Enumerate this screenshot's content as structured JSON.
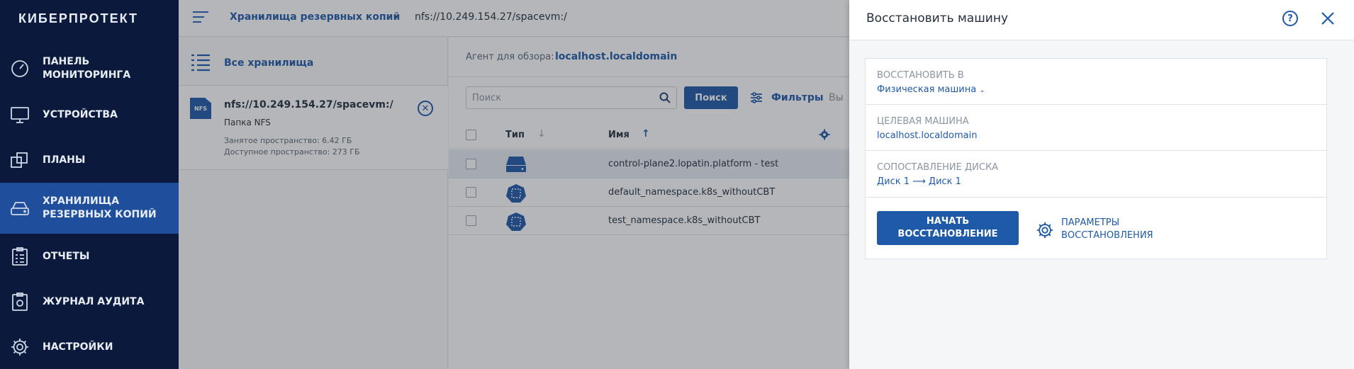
{
  "brand": "КИБЕРПРОТЕКТ",
  "sidebar": {
    "items": [
      {
        "label": "ПАНЕЛЬ МОНИТОРИНГА",
        "icon": "dashboard-icon"
      },
      {
        "label": "УСТРОЙСТВА",
        "icon": "monitor-icon"
      },
      {
        "label": "ПЛАНЫ",
        "icon": "plans-icon"
      },
      {
        "label": "ХРАНИЛИЩА РЕЗЕРВНЫХ КОПИЙ",
        "icon": "storage-icon"
      },
      {
        "label": "ОТЧЕТЫ",
        "icon": "reports-icon"
      },
      {
        "label": "ЖУРНАЛ АУДИТА",
        "icon": "audit-log-icon"
      },
      {
        "label": "НАСТРОЙКИ",
        "icon": "gear-icon"
      }
    ],
    "active": "ХРАНИЛИЩА РЕЗЕРВНЫХ КОПИЙ"
  },
  "breadcrumb": {
    "root": "Хранилища резервных копий",
    "current": "nfs://10.249.154.27/spacevm:/"
  },
  "storages": {
    "all_label": "Все хранилища",
    "card": {
      "icon_text": "NFS",
      "title": "nfs://10.249.154.27/spacevm:/",
      "type": "Папка NFS",
      "used": "Занятое пространство: 6.42 ГБ",
      "free": "Доступное пространство: 273 ГБ"
    }
  },
  "main": {
    "agent_label": "Агент для обзора:",
    "agent_value": "localhost.localdomain",
    "search_placeholder": "Поиск",
    "search_button": "Поиск",
    "filters_label": "Фильтры",
    "filters_more": "Вы",
    "columns": {
      "type": "Тип",
      "name": "Имя"
    },
    "rows": [
      {
        "name": "control-plane2.lopatin.platform - test",
        "icon": "server-icon"
      },
      {
        "name": "default_namespace.k8s_withoutCBT",
        "icon": "kubernetes-icon"
      },
      {
        "name": "test_namespace.k8s_withoutCBT",
        "icon": "kubernetes-icon"
      }
    ]
  },
  "drawer": {
    "title": "Восстановить машину",
    "restore_to_label": "ВОССТАНОВИТЬ В",
    "restore_to_value": "Физическая машина",
    "target_label": "ЦЕЛЕВАЯ МАШИНА",
    "target_value": "localhost.localdomain",
    "disk_map_label": "СОПОСТАВЛЕНИЕ ДИСКА",
    "disk_map_value": "Диск 1 ⟶ Диск 1",
    "start_line1": "НАЧАТЬ",
    "start_line2": "ВОССТАНОВЛЕНИЕ",
    "params_line1": "ПАРАМЕТРЫ",
    "params_line2": "ВОССТАНОВЛЕНИЯ"
  },
  "colors": {
    "sidebar_bg": "#0b1a3c",
    "sidebar_active": "#1f4f9c",
    "accent": "#1f5aa8"
  }
}
